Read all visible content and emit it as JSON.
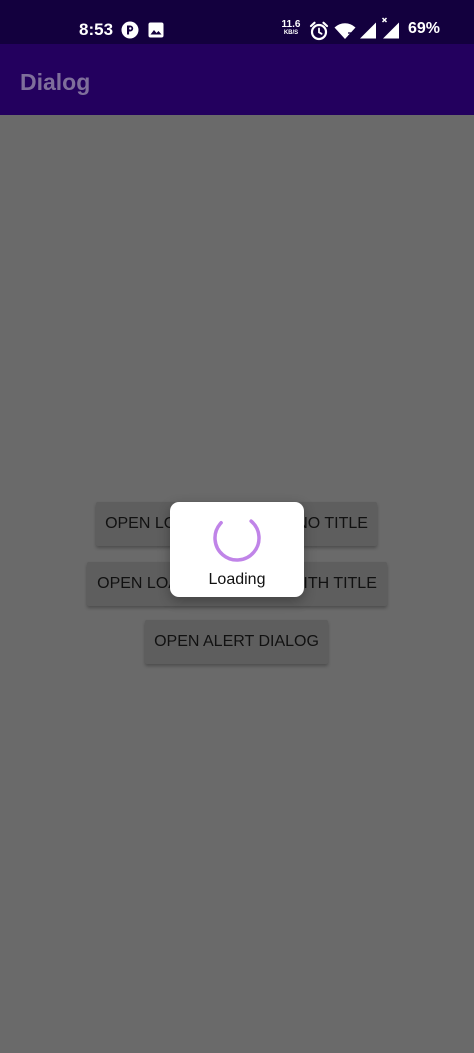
{
  "status_bar": {
    "time": "8:53",
    "left_icons": [
      "app-notification-icon",
      "image-icon"
    ],
    "network_speed_value": "11.6",
    "network_speed_unit": "KB/S",
    "right_icons": [
      "alarm-icon",
      "wifi-icon",
      "cellular-signal-icon",
      "cellular-no-data-icon"
    ],
    "battery": "69%"
  },
  "app_bar": {
    "title": "Dialog"
  },
  "main": {
    "buttons": [
      {
        "label": "OPEN LOADING DIALOG NO TITLE"
      },
      {
        "label": "OPEN LOADING DIALOG WITH TITLE"
      },
      {
        "label": "OPEN ALERT DIALOG"
      }
    ]
  },
  "dialog": {
    "label": "Loading",
    "spinner_color": "#c084e8"
  },
  "colors": {
    "status_bar": "#13003e",
    "app_bar": "#23005e",
    "scrim_background": "#6a6a6a",
    "button": "#5e5e5e",
    "dialog": "#ffffff"
  }
}
